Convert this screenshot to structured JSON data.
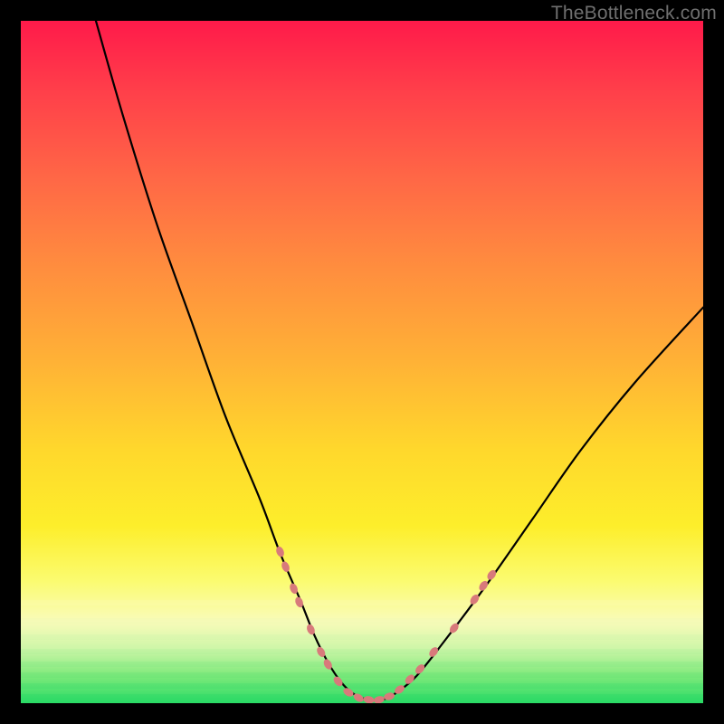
{
  "watermark": "TheBottleneck.com",
  "chart_data": {
    "type": "line",
    "title": "",
    "xlabel": "",
    "ylabel": "",
    "xlim": [
      0,
      100
    ],
    "ylim": [
      0,
      100
    ],
    "grid": false,
    "legend": false,
    "series": [
      {
        "name": "bottleneck-curve",
        "x": [
          11,
          15,
          20,
          25,
          30,
          35,
          38,
          41,
          43,
          45,
          47,
          49,
          51,
          53,
          55,
          58,
          62,
          68,
          75,
          82,
          90,
          100
        ],
        "values": [
          100,
          86,
          70,
          56,
          42,
          30,
          22,
          15,
          10,
          6,
          3,
          1.2,
          0.5,
          0.5,
          1.5,
          4,
          9,
          17,
          27,
          37,
          47,
          58
        ]
      }
    ],
    "markers": {
      "name": "highlight-beads",
      "color": "#d87a7b",
      "pill_rx": 4,
      "pill_ry": 6,
      "points": [
        {
          "x": 38.0,
          "y": 22.2
        },
        {
          "x": 38.8,
          "y": 20.0
        },
        {
          "x": 40.0,
          "y": 16.8
        },
        {
          "x": 40.8,
          "y": 14.8
        },
        {
          "x": 42.5,
          "y": 10.8
        },
        {
          "x": 44.0,
          "y": 7.5
        },
        {
          "x": 45.0,
          "y": 5.7
        },
        {
          "x": 46.5,
          "y": 3.2
        },
        {
          "x": 48.0,
          "y": 1.6
        },
        {
          "x": 49.5,
          "y": 0.8
        },
        {
          "x": 51.0,
          "y": 0.5
        },
        {
          "x": 52.5,
          "y": 0.5
        },
        {
          "x": 54.0,
          "y": 1.0
        },
        {
          "x": 55.5,
          "y": 2.0
        },
        {
          "x": 57.0,
          "y": 3.5
        },
        {
          "x": 58.5,
          "y": 5.0
        },
        {
          "x": 60.5,
          "y": 7.5
        },
        {
          "x": 63.5,
          "y": 11.0
        },
        {
          "x": 66.5,
          "y": 15.2
        },
        {
          "x": 67.8,
          "y": 17.2
        },
        {
          "x": 69.0,
          "y": 18.8
        }
      ]
    },
    "background_gradient": {
      "direction": "vertical",
      "stops": [
        {
          "pos": 0.0,
          "color": "#ff1a4a"
        },
        {
          "pos": 0.5,
          "color": "#ffb236"
        },
        {
          "pos": 0.8,
          "color": "#fbfb6f"
        },
        {
          "pos": 1.0,
          "color": "#2bdc66"
        }
      ]
    }
  }
}
